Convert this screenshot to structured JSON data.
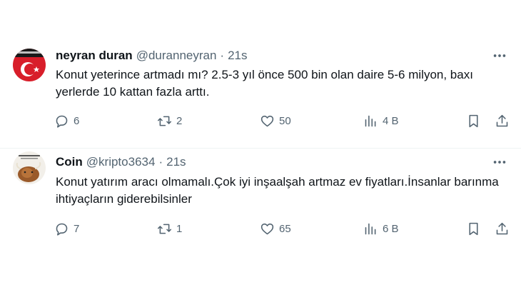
{
  "tweets": [
    {
      "display_name": "neyran duran",
      "handle": "@duranneyran",
      "separator": "·",
      "time": "21s",
      "text": "Konut yeterince artmadı mı? 2.5-3 yıl önce 500 bin olan daire 5-6 milyon, baxı yerlerde 10 kattan fazla arttı.",
      "replies": "6",
      "retweets": "2",
      "likes": "50",
      "views": "4 B"
    },
    {
      "display_name": "Coin",
      "handle": "@kripto3634",
      "separator": "·",
      "time": "21s",
      "text": "Konut yatırım aracı olmamalı.Çok iyi inşaalşah artmaz ev fiyatları.İnsanlar barınma ihtiyaçların giderebilsinler",
      "replies": "7",
      "retweets": "1",
      "likes": "65",
      "views": "6 B"
    }
  ],
  "icons": {
    "reply": "speech-bubble-icon",
    "retweet": "retweet-arrows-icon",
    "like": "heart-icon",
    "views": "bar-chart-icon",
    "bookmark": "bookmark-icon",
    "share": "share-upload-icon",
    "more": "three-dots-icon"
  },
  "colors": {
    "text": "#0f1419",
    "secondary": "#536471",
    "divider": "#eff3f4",
    "avatar1_bg": "#d81e2a"
  }
}
